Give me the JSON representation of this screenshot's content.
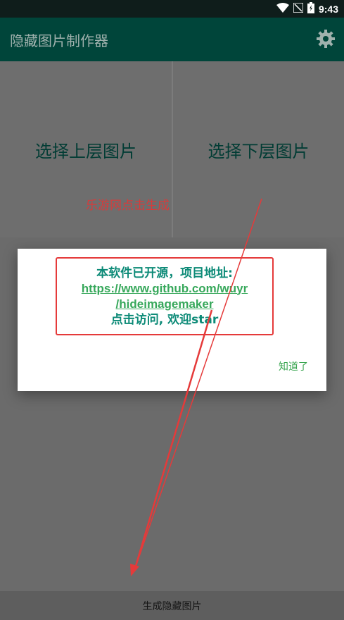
{
  "status_bar": {
    "time": "9:43"
  },
  "app_bar": {
    "title": "隐藏图片制作器",
    "settings_icon": "gear-icon"
  },
  "pickers": {
    "upper_label": "选择上层图片",
    "lower_label": "选择下层图片"
  },
  "annotation": {
    "caption": "乐游网点击生成"
  },
  "dialog": {
    "line1": "本软件已开源，项目地址:",
    "link_line1": "https://www.github.com/wuyr",
    "link_line2": "/hideimagemaker",
    "line3": "点击访问, 欢迎star",
    "ok_label": "知道了"
  },
  "bottom": {
    "generate_label": "生成隐藏图片"
  },
  "colors": {
    "app_bar": "#00453a",
    "accent": "#0c8a77",
    "link": "#37a85b",
    "highlight": "#e53a3a"
  }
}
